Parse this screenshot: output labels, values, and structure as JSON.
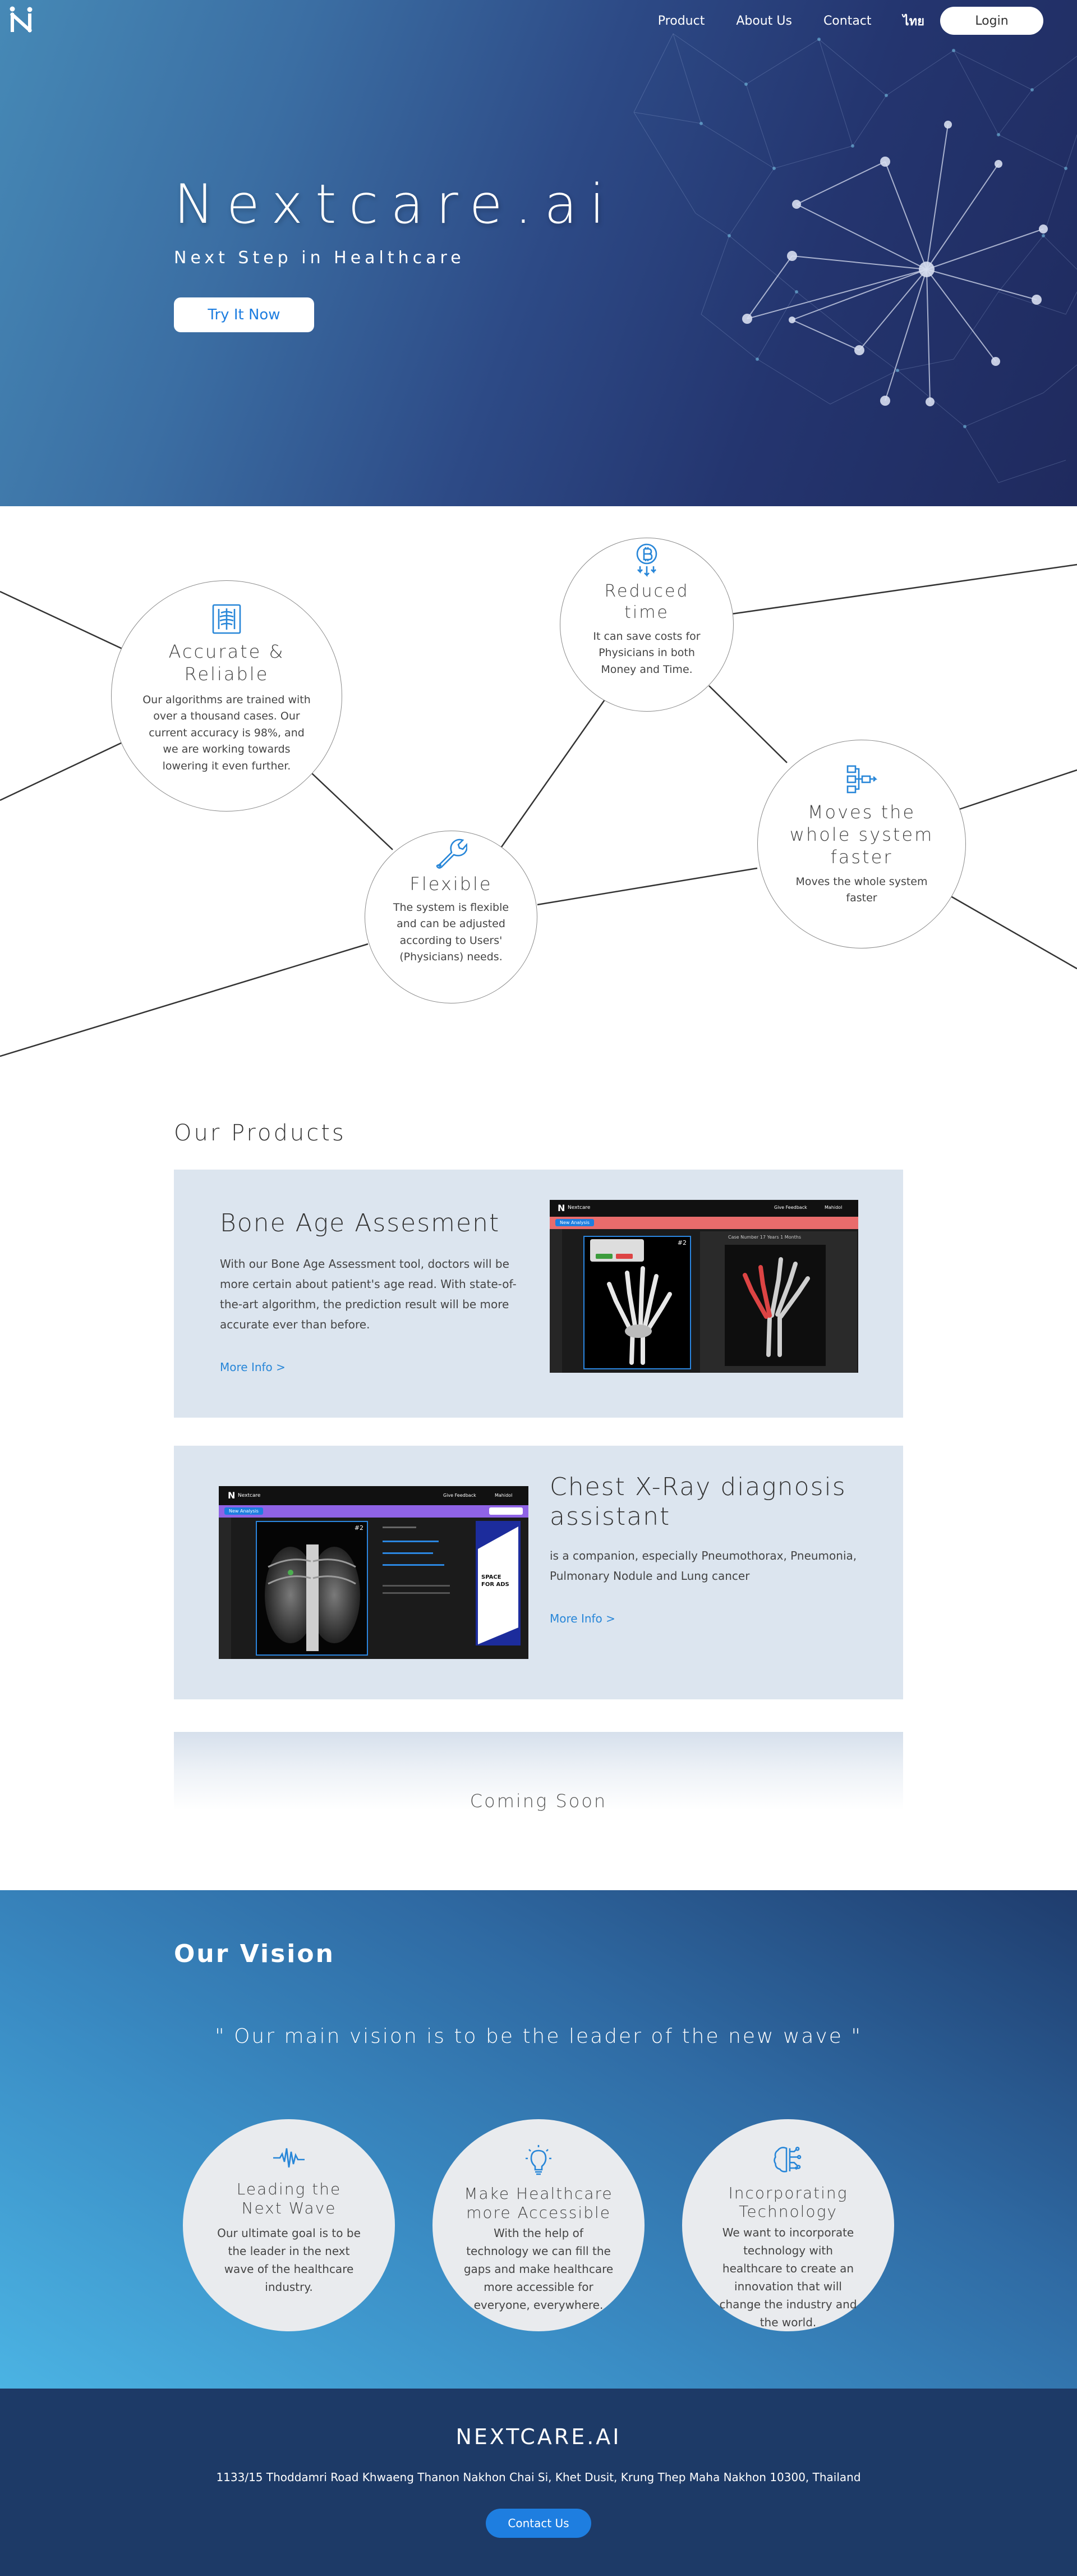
{
  "nav": {
    "links": [
      "Product",
      "About Us",
      "Contact"
    ],
    "lang": "ไทย",
    "login": "Login"
  },
  "hero": {
    "title": "Nextcare.ai",
    "subtitle": "Next Step in Healthcare",
    "cta": "Try It Now"
  },
  "features": [
    {
      "icon": "xray-icon",
      "title": "Accurate & Reliable",
      "text": "Our algorithms are trained with over a thousand cases. Our current accuracy is 98%, and we are working towards lowering it even further."
    },
    {
      "icon": "bitcoin-down-icon",
      "title": "Reduced time",
      "text": "It can save costs for Physicians in both Money and Time."
    },
    {
      "icon": "wrench-icon",
      "title": "Flexible",
      "text": "The system is flexible and can be adjusted according to Users' (Physicians) needs."
    },
    {
      "icon": "workflow-icon",
      "title": "Moves the whole system faster",
      "text": "Moves the whole system faster"
    }
  ],
  "products": {
    "title": "Our Products",
    "items": [
      {
        "title": "Bone Age Assesment",
        "text": "With our Bone Age Assessment tool, doctors will be more certain about patient's age read. With state-of-the-art algorithm, the prediction result will be more accurate ever than before.",
        "link": "More Info >"
      },
      {
        "title": "Chest X-Ray diagnosis assistant",
        "text": "is a companion, especially Pneumothorax, Pneumonia, Pulmonary Nodule and Lung cancer",
        "link": "More Info >"
      }
    ],
    "coming_soon": "Coming Soon"
  },
  "screens": {
    "bone": {
      "brand": "Nextcare",
      "btn1": "Give Feedback",
      "btn2": "Mahidol",
      "tab": "New Analysis",
      "label": "Case Number 17 Years 1 Months",
      "num": "#2"
    },
    "chest": {
      "brand": "Nextcare",
      "btn1": "Give Feedback",
      "btn2": "Mahidol",
      "tab": "New Analysis",
      "num": "#2",
      "ad": "SPACE FOR ADS"
    }
  },
  "vision": {
    "title": "Our Vision",
    "quote": "\" Our main vision is to be the leader of the new wave \"",
    "items": [
      {
        "icon": "wave-icon",
        "title": "Leading the Next Wave",
        "text": "Our ultimate goal is to be the leader in the next wave of the healthcare industry."
      },
      {
        "icon": "lightbulb-icon",
        "title": "Make Healthcare more Accessible",
        "text": "With the help of technology we can fill the gaps and make healthcare more accessible for everyone, everywhere."
      },
      {
        "icon": "brain-circuit-icon",
        "title": "Incorporating Technology",
        "text": "We want to incorporate technology with healthcare to create an innovation that will change the industry and the world."
      }
    ]
  },
  "footer": {
    "brand": "NEXTCARE.AI",
    "address": "1133/15 Thoddamri Road Khwaeng Thanon Nakhon Chai Si, Khet Dusit, Krung Thep Maha Nakhon 10300, Thailand",
    "contact": "Contact Us"
  },
  "colors": {
    "accent": "#1e7ee0",
    "footer": "#1d3a67",
    "card": "#dce5ef"
  }
}
